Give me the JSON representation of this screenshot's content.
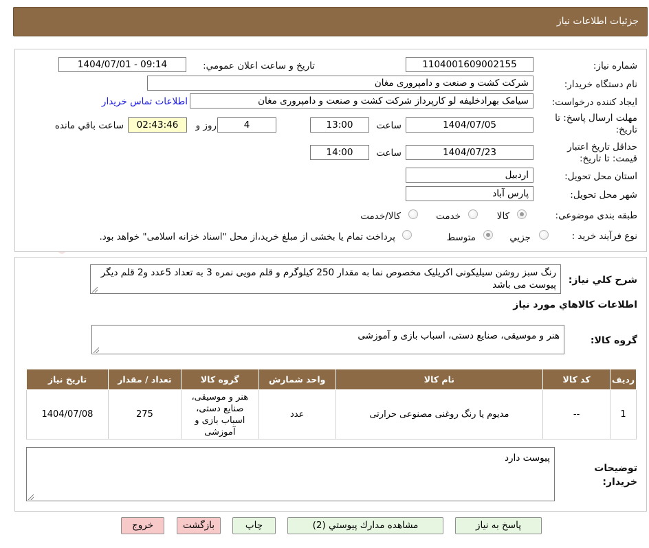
{
  "header": {
    "title": "جزئیات اطلاعات نیاز"
  },
  "form": {
    "need_number_label": "شماره نیاز:",
    "need_number": "1104001609002155",
    "announce_label": "تاریخ و ساعت اعلان عمومي:",
    "announce_value": "1404/07/01 - 09:14",
    "buyer_org_label": "نام دستگاه خريدار:",
    "buyer_org": "شرکت کشت و صنعت و دامپروری مغان",
    "requester_label": "ايجاد کننده درخواست:",
    "requester": "سیامک بهرادخلیفه لو کارپرداز شرکت کشت و صنعت و دامپروری مغان",
    "contact_link": "اطلاعات تماس خريدار",
    "reply_deadline_label": "مهلت ارسال پاسخ: تا تاریخ:",
    "reply_date": "1404/07/05",
    "time_label": "ساعت",
    "reply_time": "13:00",
    "days_value": "4",
    "days_label": "روز و",
    "remaining_time": "02:43:46",
    "remaining_label": "ساعت باقي مانده",
    "price_validity_label": "حداقل تاریخ اعتبار قیمت: تا تاریخ:",
    "price_date": "1404/07/23",
    "price_time": "14:00",
    "province_label": "استان محل تحویل:",
    "province": "اردبيل",
    "city_label": "شهر محل تحویل:",
    "city": "پارس آباد",
    "category_label": "طبقه بندی موضوعی:",
    "category_options": [
      "کالا",
      "خدمت",
      "کالا/خدمت"
    ],
    "process_label": "نوع فرآیند خرید :",
    "process_options": [
      "جزيي",
      "متوسط"
    ],
    "process_note": "پرداخت تمام یا بخشی از مبلغ خرید،از محل \"اسناد خزانه اسلامی\" خواهد بود."
  },
  "details": {
    "summary_label": "شرح كلي نياز:",
    "summary": "رنگ سبز روشن سیلیکونی اکریلیک مخصوص نما به مقدار 250 کیلوگرم و قلم مویی نمره 3 به تعداد 5عدد و2 قلم دیگر پیوست می باشد",
    "goods_info_title": "اطلاعات كالاهاي مورد نياز",
    "goods_group_label": "گروه کالا:",
    "goods_group": "هنر و موسیقی، صنایع دستی، اسباب بازی و آموزشی",
    "table": {
      "headers": [
        "رديف",
        "کد کالا",
        "نام کالا",
        "واحد شمارش",
        "گروه کالا",
        "تعداد / مقدار",
        "تاريخ نياز"
      ],
      "rows": [
        [
          "1",
          "--",
          "مدیوم یا رنگ روغنی مصنوعی حرارتی",
          "عدد",
          "هنر و موسیقی، صنایع دستی، اسباب بازی و آموزشی",
          "275",
          "1404/07/08"
        ]
      ]
    },
    "buyer_notes_label": "توضيحات خريدار:",
    "buyer_notes": "پیوست دارد"
  },
  "buttons": {
    "reply": "پاسخ به نياز",
    "attachments": "مشاهده مدارك پيوستي (2)",
    "print": "چاپ",
    "back": "بازگشت",
    "exit": "خروج"
  },
  "watermark": {
    "text": "AriaTender.neT"
  }
}
